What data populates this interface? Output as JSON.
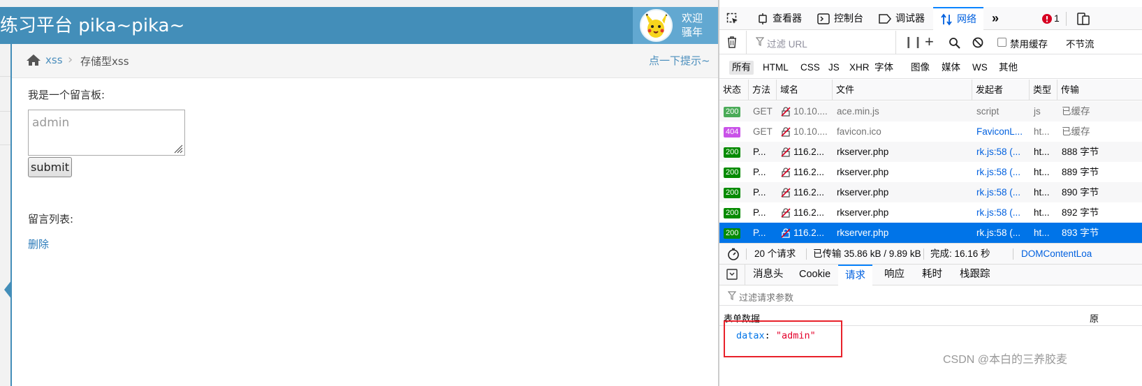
{
  "page": {
    "brand": "练习平台 pika~pika~",
    "welcome_line1": "欢迎",
    "welcome_line2": "骚年",
    "breadcrumb": {
      "parent": "xss",
      "current": "存储型xss"
    },
    "hint": "点一下提示~",
    "board_label": "我是一个留言板:",
    "input_placeholder": "admin",
    "submit_label": "submit",
    "list_label": "留言列表:",
    "delete_label": "删除"
  },
  "devtools": {
    "tabs": {
      "inspector": "查看器",
      "console": "控制台",
      "debugger": "调试器",
      "network": "网络"
    },
    "error_count": "1",
    "filter_placeholder": "过滤 URL",
    "disable_cache": "禁用缓存",
    "throttle": "不节流",
    "type_filters": [
      "所有",
      "HTML",
      "CSS",
      "JS",
      "XHR",
      "字体",
      "图像",
      "媒体",
      "WS",
      "其他"
    ],
    "columns": [
      "状态",
      "方法",
      "域名",
      "文件",
      "发起者",
      "类型",
      "传输"
    ],
    "requests": [
      {
        "status": "200",
        "status_color": "#4aab58",
        "method": "GET",
        "domain": "10.10....",
        "file": "ace.min.js",
        "initiator": "script",
        "initiator_link": false,
        "type": "js",
        "transfer": "已缓存",
        "muted": true
      },
      {
        "status": "404",
        "status_color": "#c952e8",
        "method": "GET",
        "domain": "10.10....",
        "file": "favicon.ico",
        "initiator": "FaviconL...",
        "initiator_link": true,
        "type": "ht...",
        "transfer": "已缓存",
        "muted": true
      },
      {
        "status": "200",
        "status_color": "#058b00",
        "method": "P...",
        "domain": "116.2...",
        "file": "rkserver.php",
        "initiator": "rk.js:58 (...",
        "initiator_link": true,
        "type": "ht...",
        "transfer": "888 字节",
        "muted": false
      },
      {
        "status": "200",
        "status_color": "#058b00",
        "method": "P...",
        "domain": "116.2...",
        "file": "rkserver.php",
        "initiator": "rk.js:58 (...",
        "initiator_link": true,
        "type": "ht...",
        "transfer": "889 字节",
        "muted": false
      },
      {
        "status": "200",
        "status_color": "#058b00",
        "method": "P...",
        "domain": "116.2...",
        "file": "rkserver.php",
        "initiator": "rk.js:58 (...",
        "initiator_link": true,
        "type": "ht...",
        "transfer": "890 字节",
        "muted": false
      },
      {
        "status": "200",
        "status_color": "#058b00",
        "method": "P...",
        "domain": "116.2...",
        "file": "rkserver.php",
        "initiator": "rk.js:58 (...",
        "initiator_link": true,
        "type": "ht...",
        "transfer": "892 字节",
        "muted": false
      },
      {
        "status": "200",
        "status_color": "#058b00",
        "method": "P...",
        "domain": "116.2...",
        "file": "rkserver.php",
        "initiator": "rk.js:58 (...",
        "initiator_link": true,
        "type": "ht...",
        "transfer": "893 字节",
        "muted": false,
        "selected": true
      }
    ],
    "summary": {
      "requests": "20 个请求",
      "transferred": "已传输 35.86 kB / 9.89 kB",
      "finish": "完成: 16.16 秒",
      "domcontent": "DOMContentLoa"
    },
    "detail_tabs": [
      "消息头",
      "Cookie",
      "请求",
      "响应",
      "耗时",
      "栈跟踪"
    ],
    "param_filter_placeholder": "过滤请求参数",
    "form_data_title": "表单数据",
    "form_data_edge": "原",
    "form_key": "datax",
    "form_value": "\"admin\""
  },
  "watermark": "CSDN @本白的三养胶麦"
}
